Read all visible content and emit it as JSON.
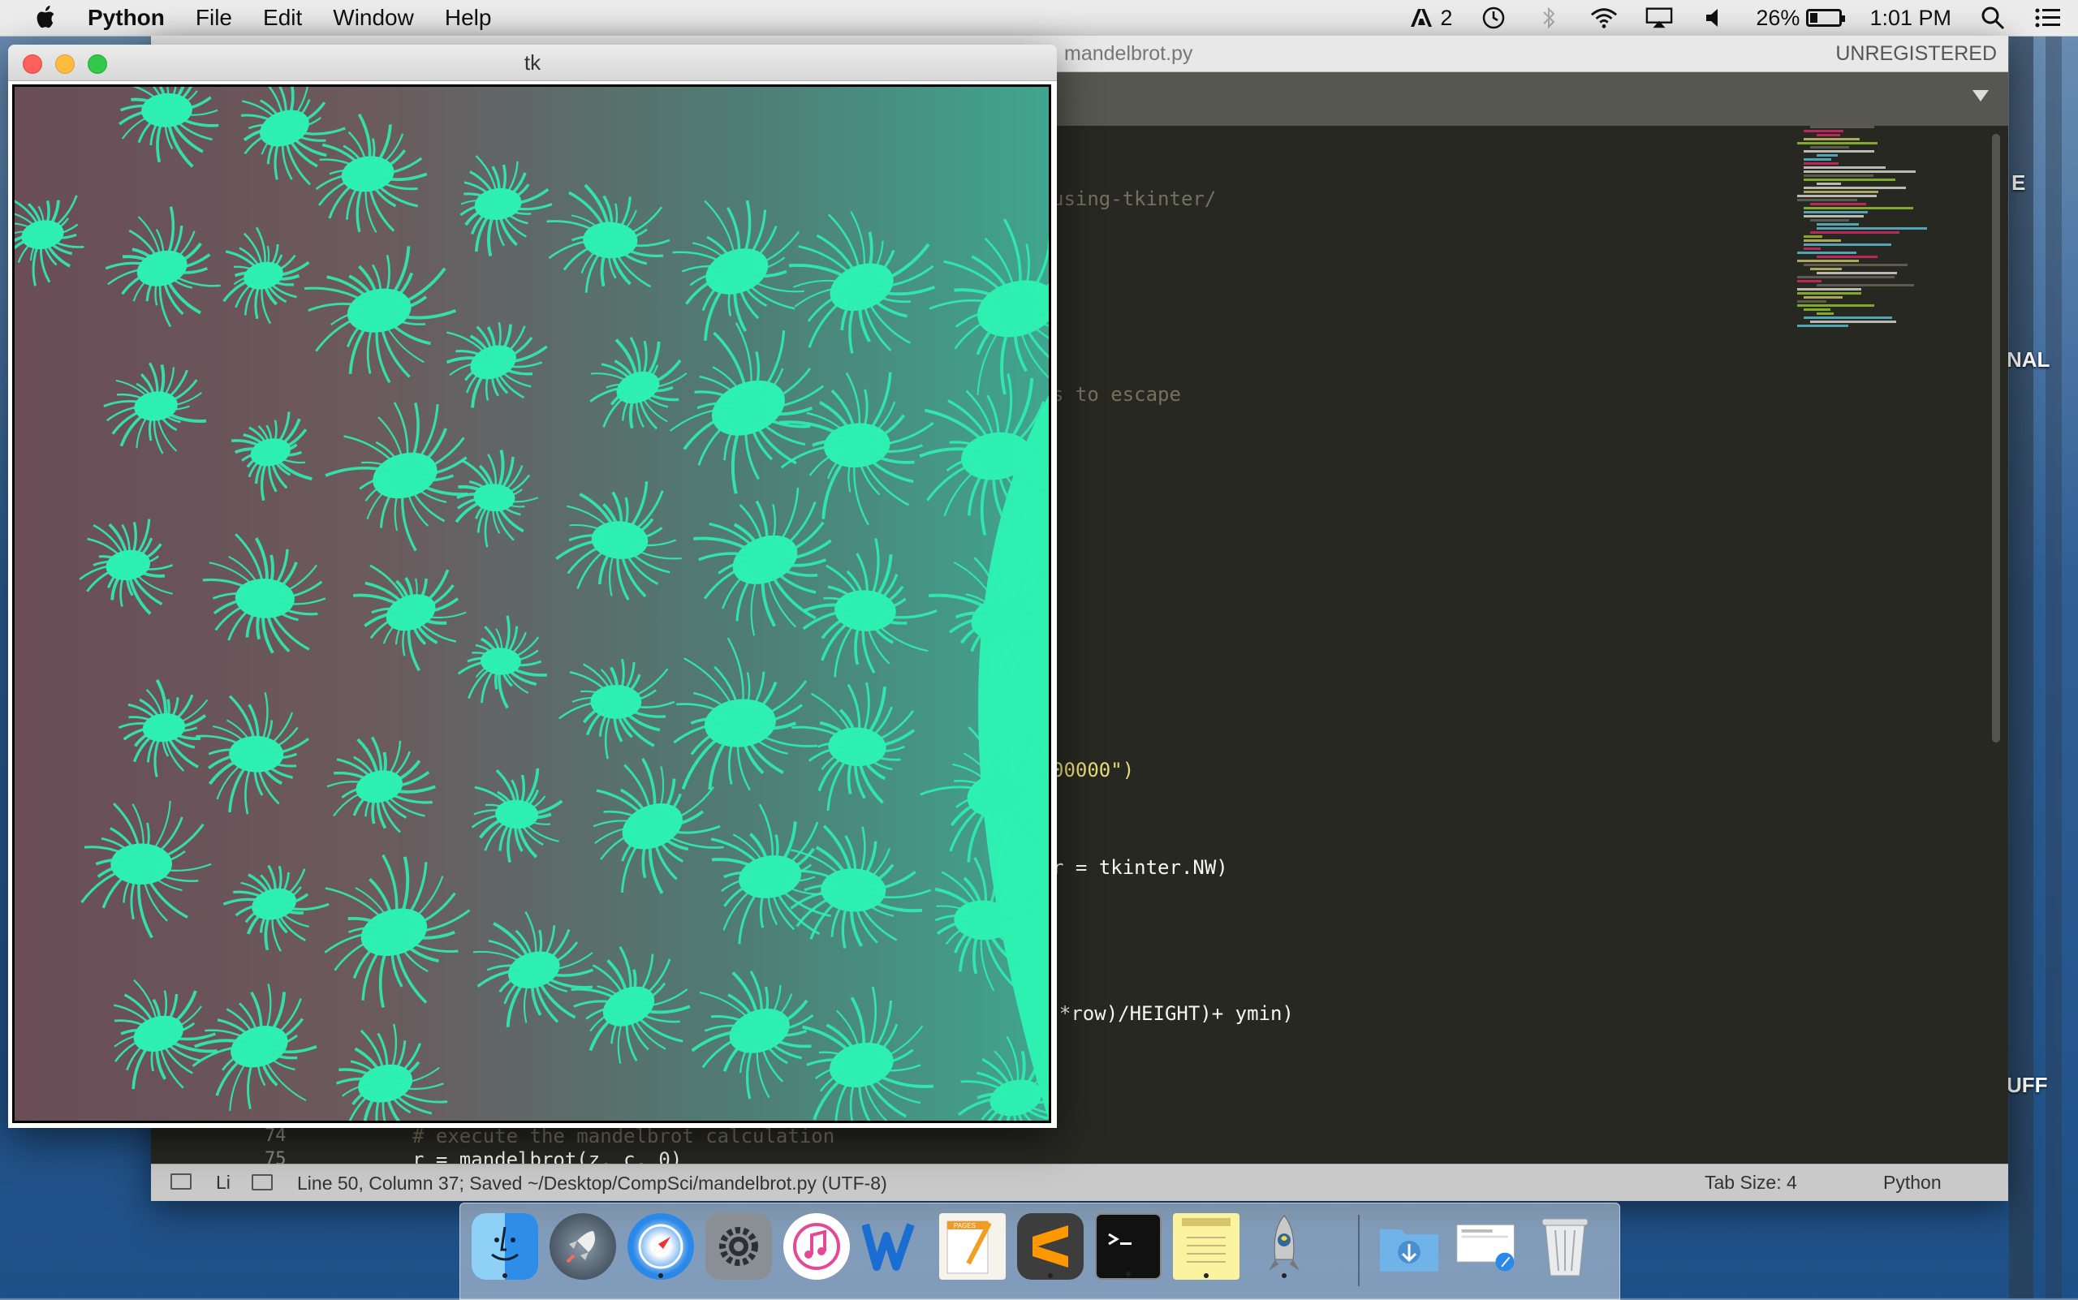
{
  "menubar": {
    "app_name": "Python",
    "items": [
      "File",
      "Edit",
      "Window",
      "Help"
    ],
    "adobe_count": "2",
    "battery_percent": "26%",
    "battery_level": 0.26,
    "clock": "1:01 PM"
  },
  "sublime": {
    "filename": "mandelbrot.py",
    "license": "UNREGISTERED",
    "visible_code": [
      {
        "text": "using-tkinter/",
        "style": "comment"
      },
      {
        "text": "s to escape",
        "style": "comment"
      },
      {
        "text": "00000\")",
        "style": "string"
      },
      {
        "text": "r = tkinter.NW)",
        "style": "code"
      },
      {
        "text": "n)*row)/HEIGHT)+ ymin)",
        "style": "code"
      }
    ],
    "bottom_lines": [
      {
        "number": "74",
        "text": "# execute the mandelbrot calculation"
      },
      {
        "number": "75",
        "text": "r = mandelbrot(z, c, 0)"
      }
    ],
    "status": {
      "position": "Line 50, Column 37; Saved ~/Desktop/CompSci/mandelbrot.py (UTF-8)",
      "hidden_prefix": "Li",
      "tab_size": "Tab Size: 4",
      "syntax": "Python"
    }
  },
  "tk_window": {
    "title": "tk"
  },
  "desktop": {
    "labels": [
      "NAL",
      "UFF"
    ],
    "partial_label": "E"
  },
  "dock": {
    "apps": [
      {
        "name": "Finder",
        "icon": "finder-icon",
        "running": true
      },
      {
        "name": "Launchpad",
        "icon": "rocket-icon",
        "running": false
      },
      {
        "name": "Safari",
        "icon": "compass-icon",
        "running": true
      },
      {
        "name": "System Preferences",
        "icon": "gear-icon",
        "running": false
      },
      {
        "name": "iTunes",
        "icon": "music-note-icon",
        "running": false
      },
      {
        "name": "Word",
        "icon": "word-icon",
        "running": false
      },
      {
        "name": "Pages",
        "icon": "pages-icon",
        "running": false
      },
      {
        "name": "Sublime Text",
        "icon": "sublime-icon",
        "running": true
      },
      {
        "name": "Terminal",
        "icon": "terminal-icon",
        "running": true
      },
      {
        "name": "Notes",
        "icon": "notes-icon",
        "running": true
      },
      {
        "name": "Python Launcher",
        "icon": "python-rocket-icon",
        "running": true
      },
      {
        "name": "Downloads",
        "icon": "downloads-folder-icon",
        "running": false
      },
      {
        "name": "Preview",
        "icon": "document-stack-icon",
        "running": false
      },
      {
        "name": "Trash",
        "icon": "trash-icon",
        "running": false
      }
    ],
    "pages_label": "PAGES"
  }
}
